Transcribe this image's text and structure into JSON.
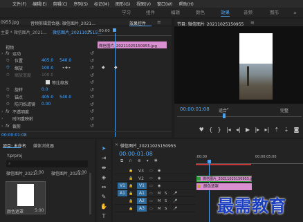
{
  "menu": [
    "文件(F)",
    "编辑(E)",
    "剪辑(C)",
    "序列(S)",
    "标记(M)",
    "图形(G)",
    "视图(V)",
    "窗口(W)",
    "帮助(H)"
  ],
  "workspaces": [
    "学习",
    "组件",
    "编辑",
    "颜色",
    "效果",
    "音频",
    "图形"
  ],
  "source_panel": {
    "clip_tab": "0955.jpg",
    "mixer_tab": "音频剪辑混合器: 微信图片_2021...",
    "effect_controls_tab": "效果控件",
    "master_label": "主要 * 微信图片_2021...",
    "seq_label": "微信图片_2021102515...",
    "ruler_start": ":00:00",
    "clip_name": "微信图片_20211025150955.jpg",
    "video_label": "视频",
    "motion_label": "运动",
    "position_label": "位置",
    "position_x": "405.0",
    "position_y": "540.0",
    "scale_label": "缩放",
    "scale_value": "100.0",
    "scale_width_label": "缩放宽度",
    "scale_width_value": "100.0",
    "uniform_label": "等比缩放",
    "rotation_label": "旋转",
    "rotation_value": "0.0",
    "anchor_label": "锚点",
    "anchor_x": "405.0",
    "anchor_y": "540.0",
    "antiflicker_label": "防闪烁滤镜",
    "antiflicker_value": "0.00",
    "opacity_label": "不透明度",
    "timeremap_label": "时间重映射",
    "crop_label": "裁剪",
    "timecode": "00:00:01:08"
  },
  "program_monitor": {
    "title": "节目: 微信图片_20211025150955",
    "timecode": "00:00:01:08",
    "fit_label": "适合",
    "full_label": "完整"
  },
  "project_panel": {
    "tab": "项目: 未命名",
    "browser_tab": "媒体浏览器",
    "file": "Y.prproj",
    "item1_name": "微信图片_2021...",
    "item1_duration": "5:00",
    "item2_name": "微信图片_2021...",
    "item2_duration": "5:00",
    "item3_name": "颜色遮罩",
    "item3_duration": "5:00"
  },
  "timeline": {
    "title": "微信图片_20211025150955",
    "timecode": "00:00:01:08",
    "ruler_start": ":00:00",
    "ruler_mid": "00:00:05:00",
    "clip_top": "微信图片_20211025150955.jpg",
    "clip_matte": "颜色遮罩",
    "tracks_video": [
      "V3",
      "V2",
      "V1"
    ],
    "tracks_audio": [
      "A1",
      "A2",
      "A3"
    ],
    "source_v": "V1",
    "source_a": "A1"
  },
  "watermark": "最需教育",
  "colors": {
    "accent_blue": "#4aa3f0",
    "clip_pink": "#d98fd0",
    "clip_green": "#2e9b3a",
    "track_blue": "#2f6c9e"
  }
}
